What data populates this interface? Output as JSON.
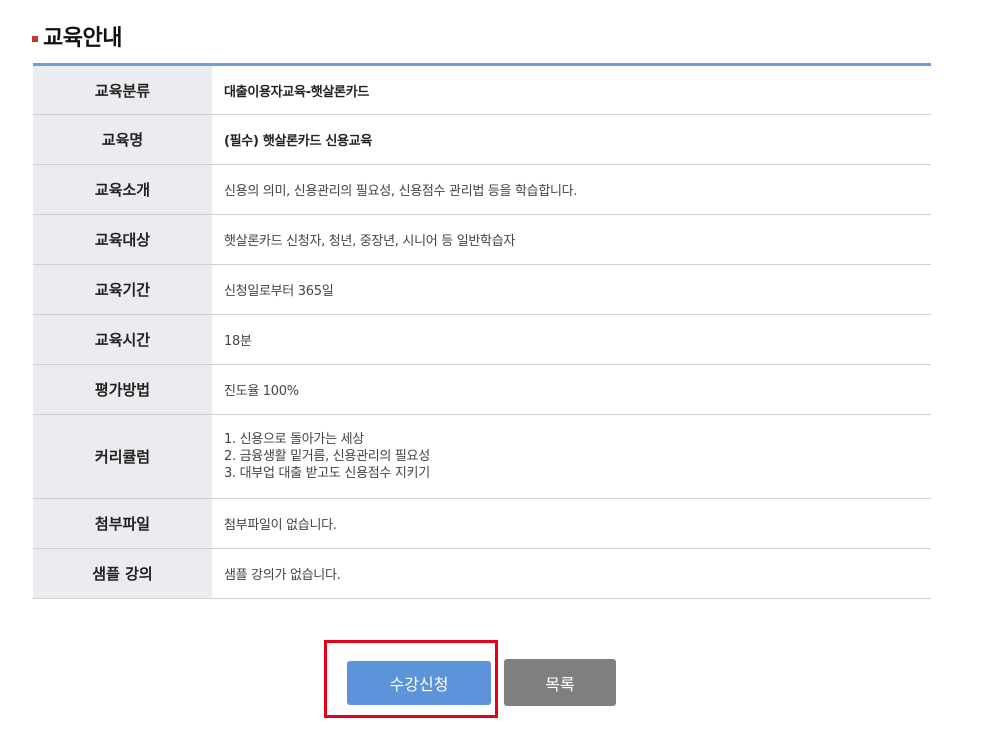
{
  "page": {
    "title": "교육안내"
  },
  "info": {
    "rows": [
      {
        "label": "교육분류",
        "value": "대출이용자교육-햇살론카드"
      },
      {
        "label": "교육명",
        "value": "(필수) 햇살론카드 신용교육"
      },
      {
        "label": "교육소개",
        "value": "신용의 의미, 신용관리의 필요성, 신용점수 관리법 등을 학습합니다."
      },
      {
        "label": "교육대상",
        "value": "햇살론카드 신청자, 청년, 중장년, 시니어 등 일반학습자"
      },
      {
        "label": "교육기간",
        "value": "신청일로부터 365일"
      },
      {
        "label": "교육시간",
        "value": "18분"
      },
      {
        "label": "평가방법",
        "value": "진도율 100%"
      },
      {
        "label": "커리큘럼",
        "lines": [
          "1. 신용으로 돌아가는 세상",
          "2. 금융생활 밑거름, 신용관리의 필요성",
          "3. 대부업 대출 받고도 신용점수 지키기"
        ]
      },
      {
        "label": "첨부파일",
        "value": "첨부파일이 없습니다."
      },
      {
        "label": "샘플 강의",
        "value": "샘플 강의가 없습니다."
      }
    ]
  },
  "buttons": {
    "apply": "수강신청",
    "list": "목록"
  },
  "colors": {
    "accent_line": "#6f9fd4",
    "apply_button": "#5d93d8",
    "list_button": "#7f7f7f",
    "highlight": "#e3001b",
    "title_bullet": "#c0392b"
  }
}
